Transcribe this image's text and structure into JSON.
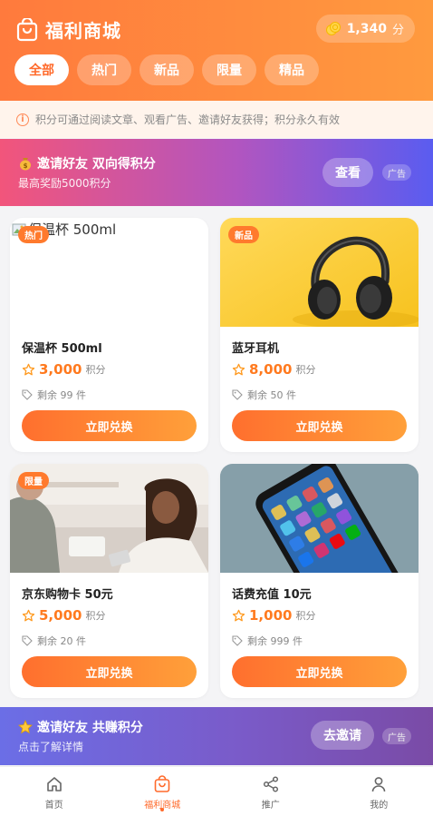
{
  "header": {
    "title": "福利商城",
    "icon": "shopping-bag-icon",
    "points_value": "1,340",
    "points_unit": "分"
  },
  "tabs": [
    {
      "label": "全部",
      "active": true
    },
    {
      "label": "热门",
      "active": false
    },
    {
      "label": "新品",
      "active": false
    },
    {
      "label": "限量",
      "active": false
    },
    {
      "label": "精品",
      "active": false
    }
  ],
  "notice": {
    "text": "积分可通过阅读文章、观看广告、邀请好友获得；积分永久有效"
  },
  "banner_top": {
    "title": "邀请好友 双向得积分",
    "subtitle": "最高奖励5000积分",
    "button": "查看",
    "ad_tag": "广告"
  },
  "products": [
    {
      "name": "保温杯 500ml",
      "price": "3,000",
      "unit": "积分",
      "stock": "剩余 99 件",
      "badge": "热门",
      "button": "立即兑换",
      "image_alt": "保温杯 500ml"
    },
    {
      "name": "蓝牙耳机",
      "price": "8,000",
      "unit": "积分",
      "stock": "剩余 50 件",
      "badge": "新品",
      "button": "立即兑换"
    },
    {
      "name": "京东购物卡 50元",
      "price": "5,000",
      "unit": "积分",
      "stock": "剩余 20 件",
      "badge": "限量",
      "button": "立即兑换"
    },
    {
      "name": "话费充值 10元",
      "price": "1,000",
      "unit": "积分",
      "stock": "剩余 999 件",
      "badge": "",
      "button": "立即兑换"
    }
  ],
  "banner_bottom": {
    "title": "邀请好友 共赚积分",
    "subtitle": "点击了解详情",
    "button": "去邀请",
    "ad_tag": "广告"
  },
  "nav": [
    {
      "label": "首页",
      "icon": "home-icon",
      "active": false
    },
    {
      "label": "福利商城",
      "icon": "shopping-bag-icon",
      "active": true
    },
    {
      "label": "推广",
      "icon": "share-icon",
      "active": false
    },
    {
      "label": "我的",
      "icon": "user-icon",
      "active": false
    }
  ],
  "colors": {
    "accent": "#ff6a2b",
    "header_start": "#ff7a3d",
    "header_end": "#ff9a3e",
    "price": "#ff7a1f"
  }
}
